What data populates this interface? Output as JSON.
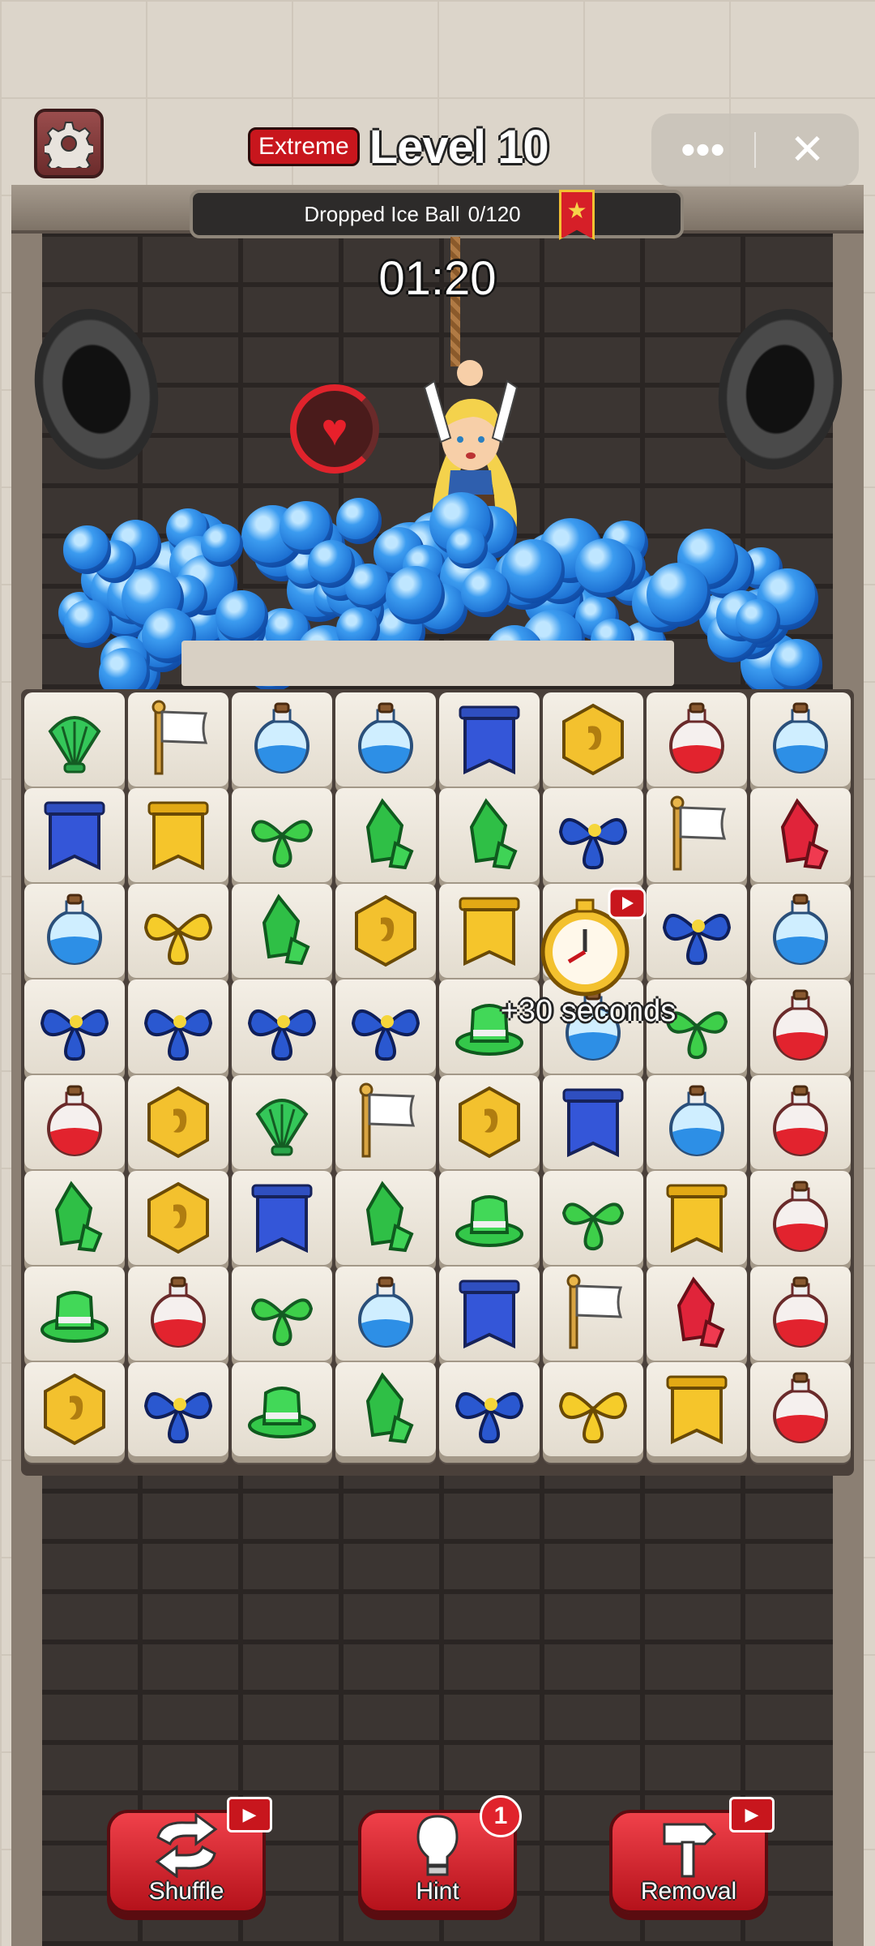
{
  "header": {
    "difficulty": "Extreme",
    "level_title": "Level 10",
    "settings_icon": "gear-icon",
    "more_icon": "more-dots-icon",
    "close_icon": "close-icon"
  },
  "goal": {
    "label": "Dropped Ice Ball",
    "progress": "0/120",
    "ribbon_icon": "star-ribbon-icon"
  },
  "timer": "01:20",
  "powerup": {
    "label": "+30 seconds",
    "icon": "stopwatch-icon",
    "badge_icon": "video-icon"
  },
  "board": {
    "rows": [
      [
        "shell",
        "flag",
        "blue-potion",
        "blue-potion",
        "blue-banner",
        "gold-coin",
        "red-potion",
        "blue-potion"
      ],
      [
        "blue-banner",
        "gold-banner",
        "green-leaves",
        "green-crystal",
        "green-crystal",
        "blue-flower",
        "flag",
        "red-crystal"
      ],
      [
        "blue-potion",
        "yellow-flower",
        "green-crystal",
        "gold-coin",
        "gold-banner",
        "stopwatch",
        "blue-flower",
        "blue-potion"
      ],
      [
        "blue-flower",
        "blue-flower",
        "blue-flower",
        "blue-flower",
        "green-hat",
        "blue-potion",
        "green-leaves",
        "red-potion"
      ],
      [
        "red-potion",
        "gold-coin",
        "shell",
        "flag",
        "gold-coin",
        "blue-banner",
        "blue-potion",
        "red-potion"
      ],
      [
        "green-crystal",
        "gold-coin",
        "blue-banner",
        "green-crystal",
        "green-hat",
        "green-leaves",
        "gold-banner",
        "red-potion"
      ],
      [
        "green-hat",
        "red-potion",
        "green-leaves",
        "blue-potion",
        "blue-banner",
        "flag",
        "red-crystal",
        "red-potion"
      ],
      [
        "gold-coin",
        "blue-flower",
        "green-hat",
        "green-crystal",
        "blue-flower",
        "yellow-flower",
        "gold-banner",
        "red-potion"
      ]
    ]
  },
  "tools": {
    "shuffle": {
      "label": "Shuffle",
      "icon": "shuffle-icon",
      "badge_icon": "video-icon"
    },
    "hint": {
      "label": "Hint",
      "icon": "lightbulb-icon",
      "count": "1"
    },
    "removal": {
      "label": "Removal",
      "icon": "hammer-icon",
      "badge_icon": "video-icon"
    }
  },
  "colors": {
    "difficulty_red": "#c8161d",
    "tool_red": "#e0232c",
    "ice_blue": "#1e78de",
    "tile_bg": "#f1ece3"
  }
}
